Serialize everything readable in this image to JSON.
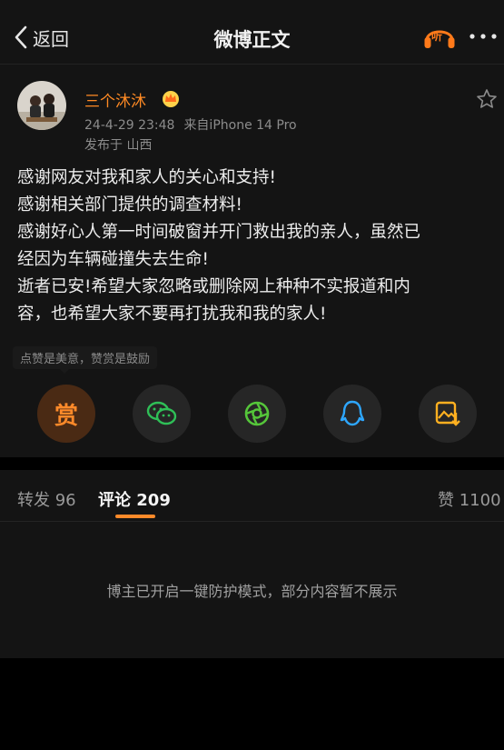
{
  "header": {
    "back_label": "返回",
    "title": "微博正文",
    "listen_label": "听"
  },
  "post": {
    "username": "三个沐沐",
    "timestamp": "24-4-29 23:48",
    "source": "来自iPhone 14 Pro",
    "location": "发布于 山西",
    "content_lines": [
      "感谢网友对我和家人的关心和支持!",
      "感谢相关部门提供的调查材料!",
      "感谢好心人第一时间破窗并开门救出我的亲人，虽然已",
      "经因为车辆碰撞失去生命!",
      "逝者已安!希望大家忽略或删除网上种种不实报道和内",
      "容，也希望大家不要再打扰我和我的家人!"
    ],
    "reward_hint": "点赞是美意，赞赏是鼓励",
    "reward_glyph": "赏"
  },
  "tabs": {
    "repost_label": "转发",
    "repost_count": "96",
    "comment_label": "评论",
    "comment_count": "209",
    "like_label": "赞",
    "like_count": "1100"
  },
  "comments": {
    "notice": "博主已开启一键防护模式，部分内容暂不展示"
  },
  "colors": {
    "accent": "#ff8a2a",
    "background": "#000000",
    "panel": "#141414"
  }
}
